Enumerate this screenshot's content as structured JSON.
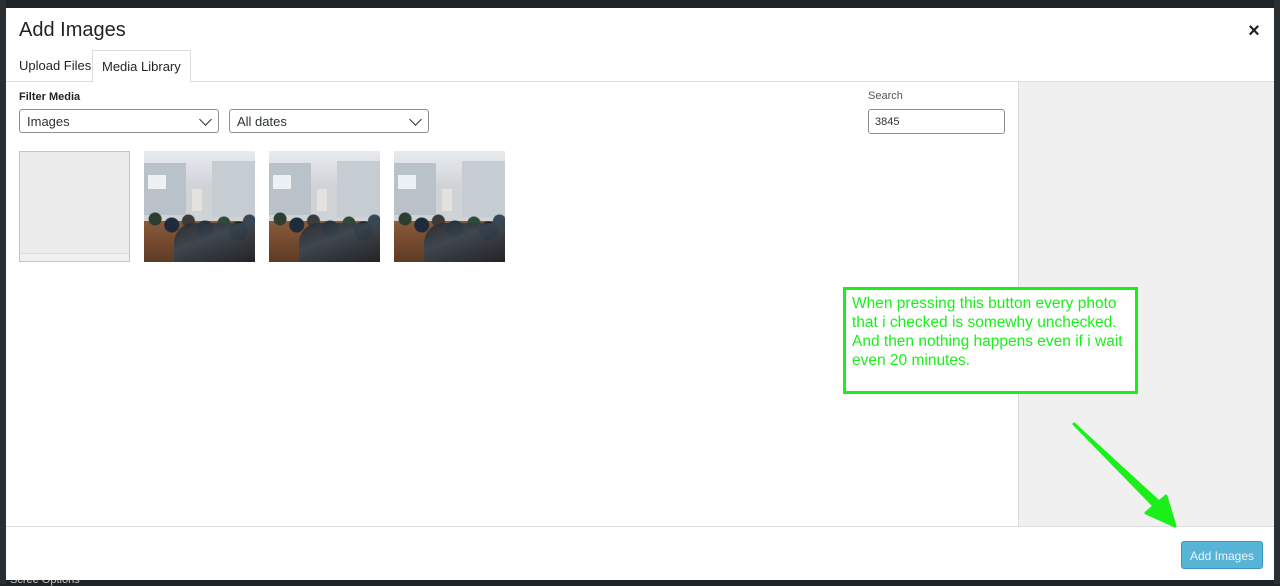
{
  "modal": {
    "title": "Add Images",
    "close_label": "×"
  },
  "tabs": [
    {
      "label": "Upload Files",
      "active": false
    },
    {
      "label": "Media Library",
      "active": true
    }
  ],
  "filters": {
    "label": "Filter Media",
    "type_selected": "Images",
    "date_selected": "All dates"
  },
  "search": {
    "label": "Search",
    "value": "3845"
  },
  "attachments": [
    {
      "kind": "placeholder"
    },
    {
      "kind": "photo"
    },
    {
      "kind": "photo"
    },
    {
      "kind": "photo"
    }
  ],
  "toolbar": {
    "add_button_label": "Add Images",
    "add_button_color": "#2ea2cc"
  },
  "annotation": {
    "text": "When pressing this button every photo that i checked is somewhy unchecked. And then nothing happens even if i wait even 20 minutes.",
    "color": "#1aef1a"
  },
  "background": {
    "footer_text": "Scree Options"
  }
}
